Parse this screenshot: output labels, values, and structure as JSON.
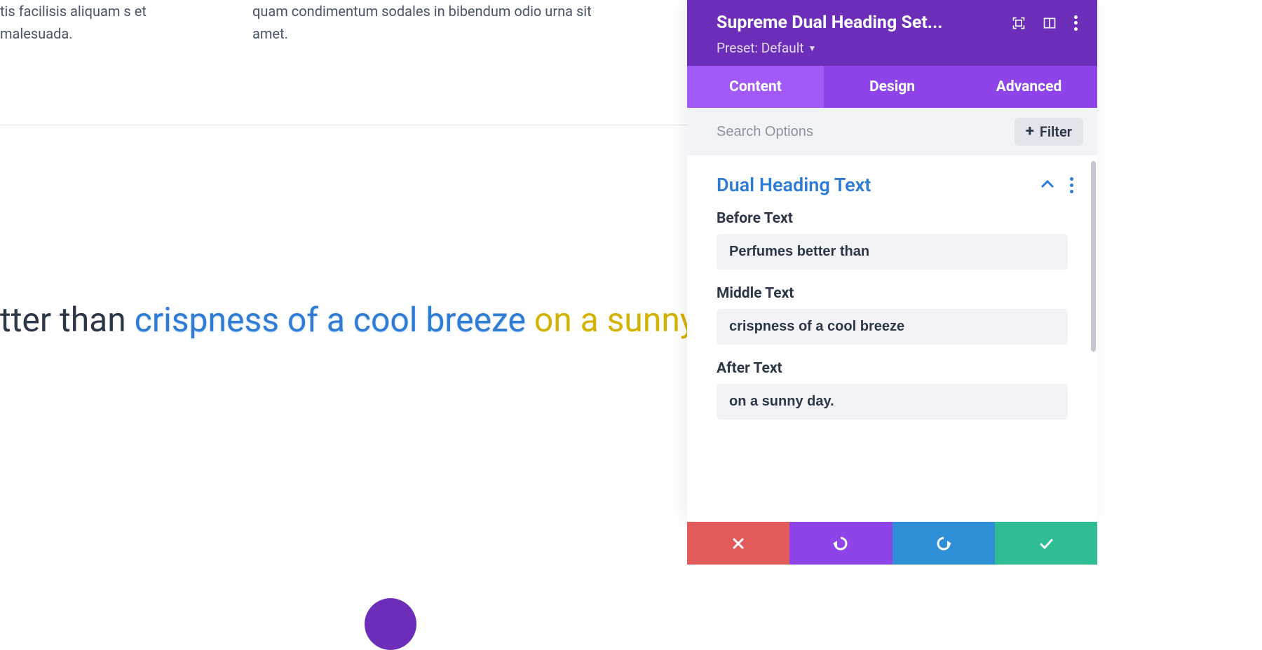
{
  "preview": {
    "lorem_left": "tis facilisis aliquam s et malesuada.",
    "lorem_right": "quam condimentum sodales in bibendum odio urna sit amet.",
    "before": "tter than ",
    "middle": "crispness of a cool breeze",
    "after": " on a sunny day."
  },
  "panel": {
    "title": "Supreme Dual Heading Set...",
    "preset_label": "Preset: Default",
    "tabs": {
      "content": "Content",
      "design": "Design",
      "advanced": "Advanced"
    },
    "search_placeholder": "Search Options",
    "filter_label": "Filter",
    "section_title": "Dual Heading Text",
    "fields": {
      "before": {
        "label": "Before Text",
        "value": "Perfumes better than"
      },
      "middle": {
        "label": "Middle Text",
        "value": "crispness of a cool breeze"
      },
      "after": {
        "label": "After Text",
        "value": "on a sunny day."
      }
    }
  }
}
